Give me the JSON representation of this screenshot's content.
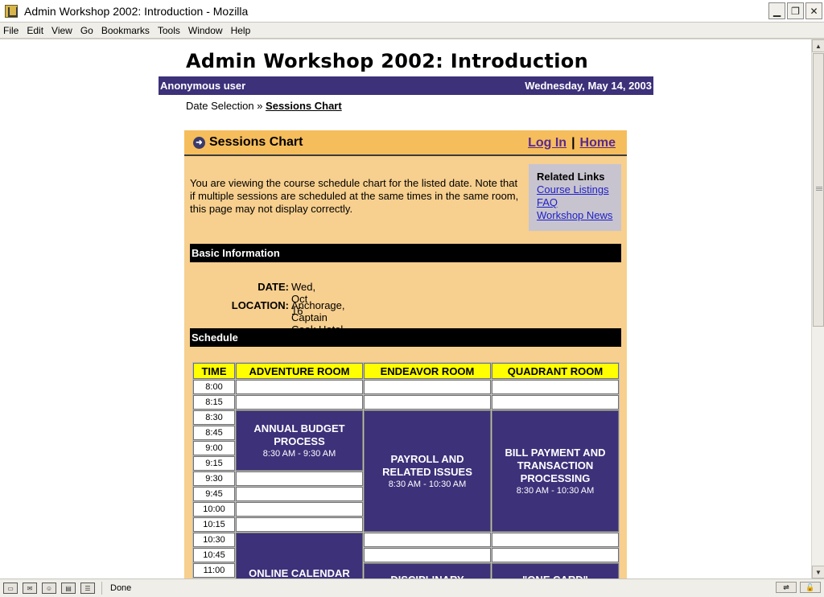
{
  "window": {
    "title": "Admin Workshop 2002: Introduction - Mozilla",
    "buttons": [
      "minimize",
      "restore",
      "close"
    ]
  },
  "menu": [
    "File",
    "Edit",
    "View",
    "Go",
    "Bookmarks",
    "Tools",
    "Window",
    "Help"
  ],
  "page": {
    "title": "Admin Workshop 2002: Introduction",
    "user": "Anonymous user",
    "date": "Wednesday, May 14, 2003",
    "breadcrumb": {
      "first": "Date Selection",
      "sep": "»",
      "current": "Sessions Chart"
    }
  },
  "panel": {
    "title": "Sessions Chart",
    "login": "Log In",
    "link_sep": "|",
    "home": "Home",
    "intro": "You are viewing the course schedule chart for the listed date. Note that if multiple sessions are scheduled at the same times in the same room, this page may not display correctly.",
    "related": {
      "heading": "Related Links",
      "links": [
        "Course Listings",
        "FAQ",
        "Workshop News"
      ]
    },
    "basic": {
      "heading": "Basic Information",
      "date_label": "DATE:",
      "date_value": "Wed, Oct 16",
      "location_label": "LOCATION:",
      "location_value": "Anchorage, Captain Cook Hotel"
    },
    "schedule": {
      "heading": "Schedule",
      "headers": [
        "TIME",
        "ADVENTURE ROOM",
        "ENDEAVOR ROOM",
        "QUADRANT ROOM"
      ],
      "times": [
        "8:00",
        "8:15",
        "8:30",
        "8:45",
        "9:00",
        "9:15",
        "9:30",
        "9:45",
        "10:00",
        "10:15",
        "10:30",
        "10:45",
        "11:00"
      ],
      "sessions": [
        {
          "title": "ANNUAL BUDGET PROCESS",
          "time": "8:30 AM - 9:30 AM"
        },
        {
          "title": "PAYROLL AND RELATED ISSUES",
          "time": "8:30 AM - 10:30 AM"
        },
        {
          "title": "BILL PAYMENT AND TRANSACTION PROCESSING",
          "time": "8:30 AM - 10:30 AM"
        },
        {
          "title": "ONLINE CALENDAR",
          "time": ""
        },
        {
          "title": "DISCIPLINARY",
          "time": ""
        },
        {
          "title": "\"ONE CARD\"",
          "time": ""
        }
      ]
    }
  },
  "status": {
    "text": "Done"
  }
}
